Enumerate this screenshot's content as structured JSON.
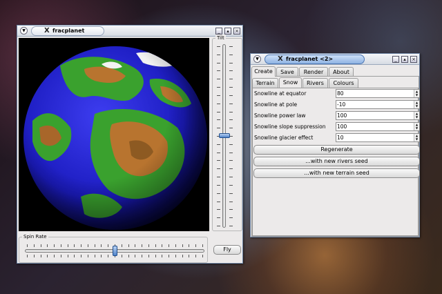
{
  "window_main": {
    "title": "fracplanet",
    "tilt_label": "Tilt",
    "tilt_value": 0.5,
    "spin_label": "Spin Rate",
    "spin_value": 0.5,
    "fly_label": "Fly"
  },
  "window_controls": {
    "title": "fracplanet <2>",
    "tabs": [
      "Create",
      "Save",
      "Render",
      "About"
    ],
    "active_tab": "Create",
    "subtabs": [
      "Terrain",
      "Snow",
      "Rivers",
      "Colours"
    ],
    "active_subtab": "Snow",
    "fields": [
      {
        "label": "Snowline at equator",
        "value": "80"
      },
      {
        "label": "Snowline at pole",
        "value": "-10"
      },
      {
        "label": "Snowline power law",
        "value": "100"
      },
      {
        "label": "Snowline slope suppression",
        "value": "100"
      },
      {
        "label": "Snowline glacier effect",
        "value": "10"
      }
    ],
    "buttons": {
      "regenerate": "Regenerate",
      "rivers_seed": "...with new rivers seed",
      "terrain_seed": "...with new terrain seed"
    }
  },
  "colors": {
    "active_title": "#8fb3e3",
    "ocean": "#1f1fc8",
    "land": "#3aa12e",
    "mountain": "#b8742f"
  },
  "icons": [
    "window-menu-icon",
    "x-logo-icon",
    "minimize-icon",
    "maximize-icon",
    "close-icon",
    "spin-up-icon",
    "spin-down-icon"
  ]
}
